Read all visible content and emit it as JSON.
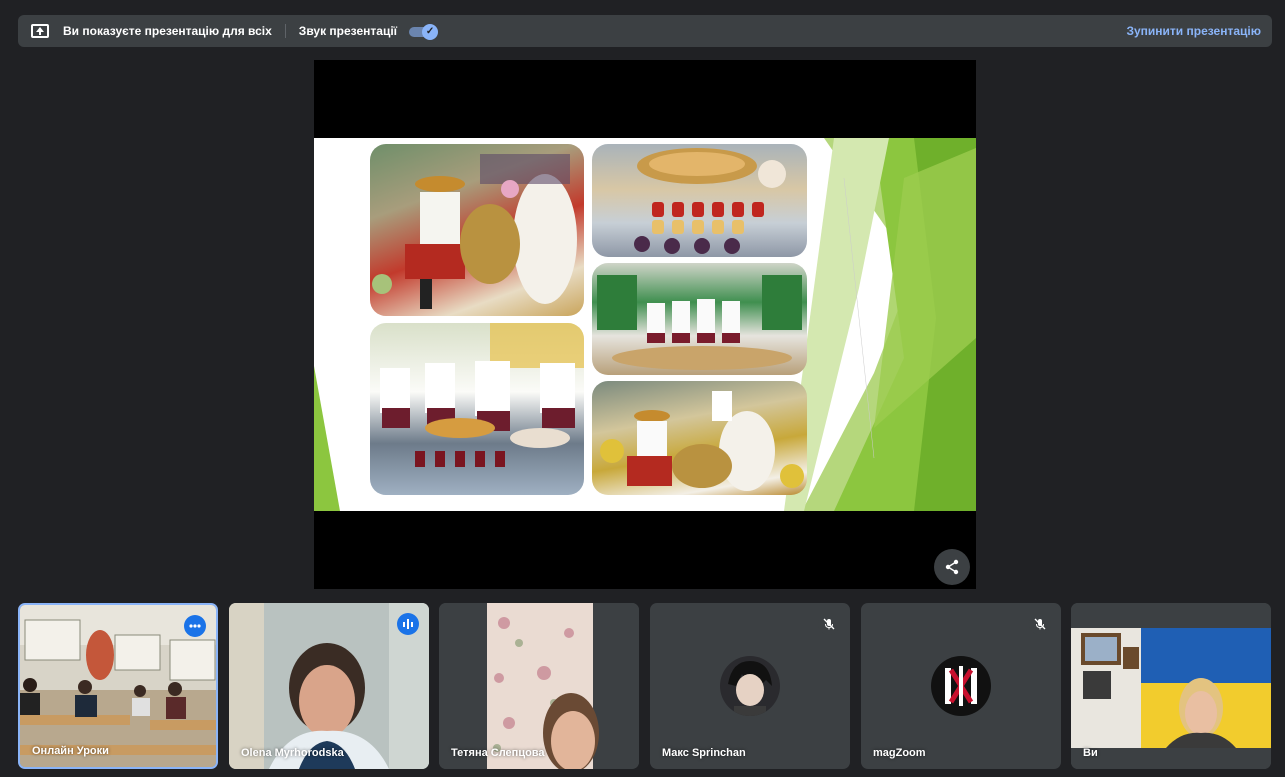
{
  "presenting_bar": {
    "message": "Ви показуєте презентацію для всіх",
    "sound_label": "Звук презентації",
    "sound_on": true,
    "stop_label": "Зупинити презентацію"
  },
  "colors": {
    "background": "#202124",
    "surface": "#3c4043",
    "accent": "#8ab4f8",
    "badge_blue": "#1a73e8",
    "slide_green": "#7cbf2e"
  },
  "participants": [
    {
      "name": "Онлайн Уроки",
      "indicator": "more-options",
      "active": true
    },
    {
      "name": "Olena Myrhorodska",
      "indicator": "speaking"
    },
    {
      "name": "Тетяна Слепцова",
      "indicator": "none"
    },
    {
      "name": "Макс Sprinchan",
      "indicator": "mic-off"
    },
    {
      "name": "magZoom",
      "indicator": "mic-off"
    },
    {
      "name": "Ви",
      "indicator": "none"
    }
  ]
}
